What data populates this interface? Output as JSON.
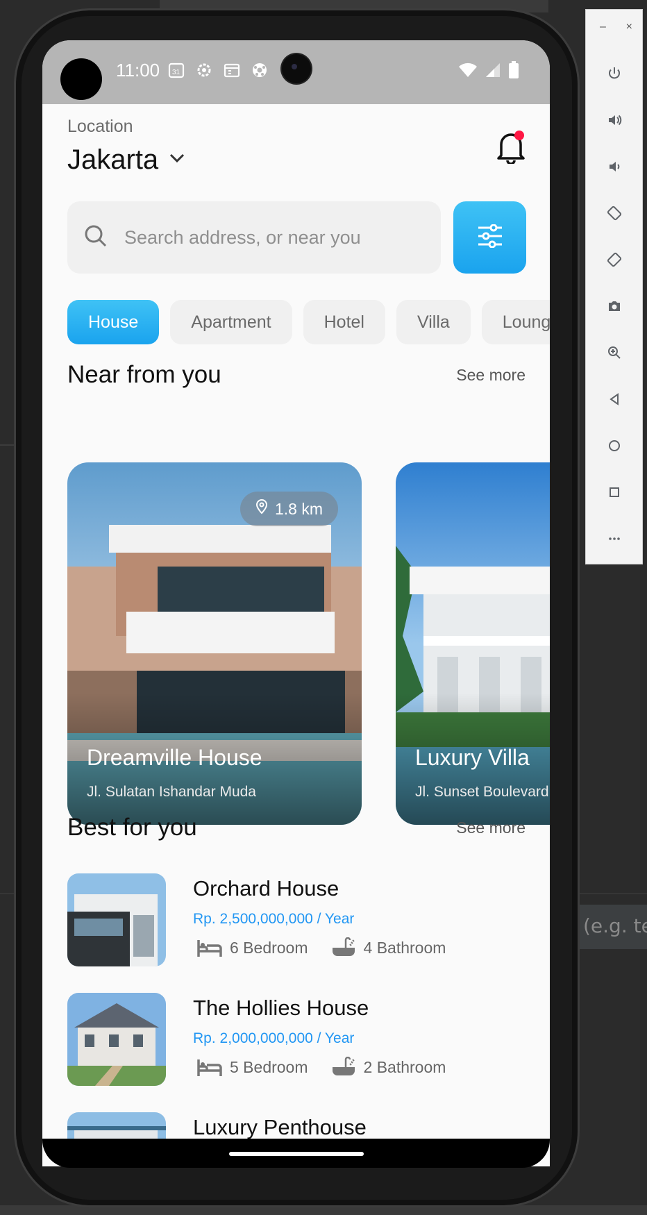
{
  "ide": {
    "hint_text": "(e.g. tex"
  },
  "status_bar": {
    "time": "11:00"
  },
  "location": {
    "label": "Location",
    "city": "Jakarta"
  },
  "search": {
    "placeholder": "Search address, or near you"
  },
  "categories": [
    "House",
    "Apartment",
    "Hotel",
    "Villa",
    "Lounge"
  ],
  "active_category": "House",
  "near": {
    "title": "Near from you",
    "see_more": "See more",
    "cards": [
      {
        "title": "Dreamville House",
        "address": "Jl. Sulatan Ishandar Muda",
        "distance": "1.8 km"
      },
      {
        "title": "Luxury Villa",
        "address": "Jl. Sunset Boulevard",
        "distance": ""
      }
    ]
  },
  "best": {
    "title": "Best for you",
    "see_more": "See more",
    "items": [
      {
        "title": "Orchard House",
        "price": "Rp. 2,500,000,000 / Year",
        "bedrooms": "6 Bedroom",
        "bathrooms": "4 Bathroom"
      },
      {
        "title": "The Hollies House",
        "price": "Rp. 2,000,000,000 / Year",
        "bedrooms": "5 Bedroom",
        "bathrooms": "2 Bathroom"
      },
      {
        "title": "Luxury Penthouse",
        "price": "",
        "bedrooms": "",
        "bathrooms": ""
      }
    ]
  },
  "colors": {
    "accent": "#29B6F6",
    "price": "#2196F3",
    "notification_dot": "#FF1744"
  },
  "emulator_toolbar": [
    "power-icon",
    "volume-up-icon",
    "volume-down-icon",
    "rotate-left-icon",
    "rotate-right-icon",
    "camera-icon",
    "zoom-icon",
    "back-icon",
    "home-icon",
    "overview-icon",
    "more-icon"
  ]
}
